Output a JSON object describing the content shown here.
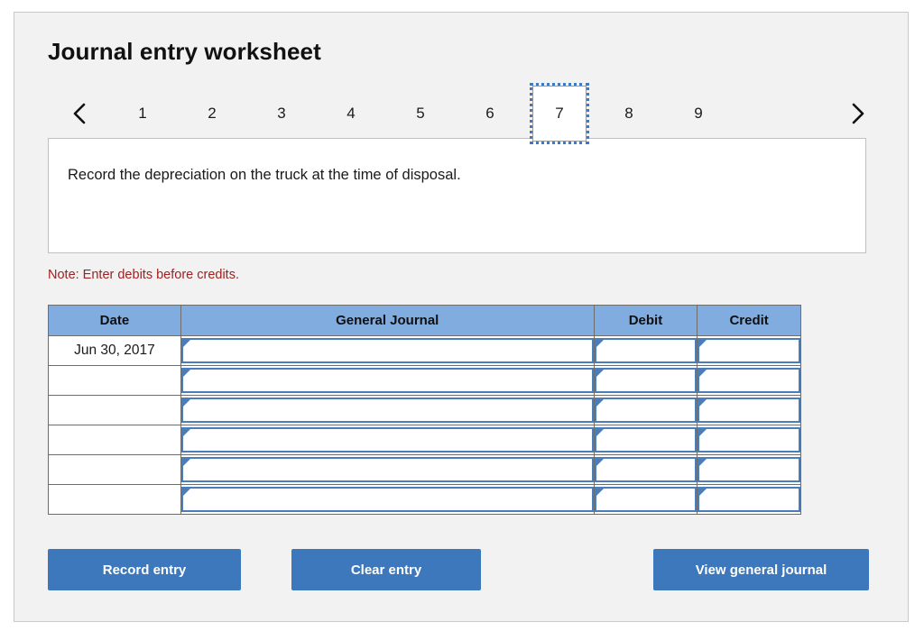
{
  "worksheet": {
    "title": "Journal entry worksheet",
    "instruction": "Record the depreciation on the truck at the time of disposal.",
    "note": "Note: Enter debits before credits."
  },
  "pager": {
    "prev_icon": "chevron-left-icon",
    "next_icon": "chevron-right-icon",
    "active_page": "7",
    "pages": [
      "1",
      "2",
      "3",
      "4",
      "5",
      "6",
      "7",
      "8",
      "9"
    ]
  },
  "table": {
    "headers": {
      "date": "Date",
      "general_journal": "General Journal",
      "debit": "Debit",
      "credit": "Credit"
    },
    "rows": [
      {
        "date": "Jun 30, 2017",
        "general_journal": "",
        "debit": "",
        "credit": ""
      },
      {
        "date": "",
        "general_journal": "",
        "debit": "",
        "credit": ""
      },
      {
        "date": "",
        "general_journal": "",
        "debit": "",
        "credit": ""
      },
      {
        "date": "",
        "general_journal": "",
        "debit": "",
        "credit": ""
      },
      {
        "date": "",
        "general_journal": "",
        "debit": "",
        "credit": ""
      },
      {
        "date": "",
        "general_journal": "",
        "debit": "",
        "credit": ""
      }
    ]
  },
  "actions": {
    "record_entry": "Record entry",
    "clear_entry": "Clear entry",
    "view_general_journal": "View general journal"
  },
  "colors": {
    "panel_background": "#f2f2f2",
    "header_blue": "#80acdf",
    "button_blue": "#3c78bb",
    "field_border_blue": "#4a7ebb",
    "note_red": "#a32020",
    "tab_focus_blue": "#3f7ac0"
  }
}
